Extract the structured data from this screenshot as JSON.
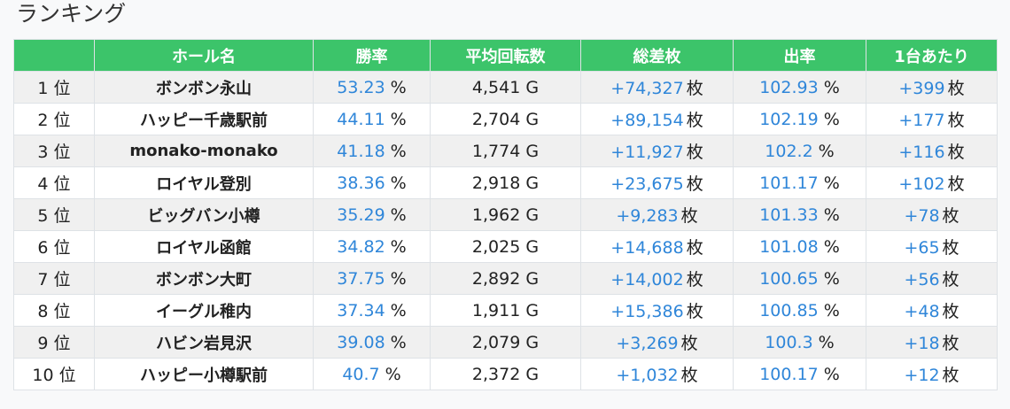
{
  "page": {
    "title": "ランキング"
  },
  "table": {
    "headers": [
      "",
      "ホール名",
      "勝率",
      "平均回転数",
      "総差枚",
      "出率",
      "1台あたり"
    ],
    "units": {
      "percent": "%",
      "spins": "G",
      "coins": "枚"
    },
    "rows": [
      {
        "rank": "1 位",
        "hall": "ボンボン永山",
        "win_rate": "53.23",
        "avg_spins": "4,541",
        "total_diff": "+74,327",
        "payout": "102.93",
        "per_machine": "+399"
      },
      {
        "rank": "2 位",
        "hall": "ハッピー千歳駅前",
        "win_rate": "44.11",
        "avg_spins": "2,704",
        "total_diff": "+89,154",
        "payout": "102.19",
        "per_machine": "+177"
      },
      {
        "rank": "3 位",
        "hall": "monako-monako",
        "win_rate": "41.18",
        "avg_spins": "1,774",
        "total_diff": "+11,927",
        "payout": "102.2",
        "per_machine": "+116"
      },
      {
        "rank": "4 位",
        "hall": "ロイヤル登別",
        "win_rate": "38.36",
        "avg_spins": "2,918",
        "total_diff": "+23,675",
        "payout": "101.17",
        "per_machine": "+102"
      },
      {
        "rank": "5 位",
        "hall": "ビッグバン小樽",
        "win_rate": "35.29",
        "avg_spins": "1,962",
        "total_diff": "+9,283",
        "payout": "101.33",
        "per_machine": "+78"
      },
      {
        "rank": "6 位",
        "hall": "ロイヤル函館",
        "win_rate": "34.82",
        "avg_spins": "2,025",
        "total_diff": "+14,688",
        "payout": "101.08",
        "per_machine": "+65"
      },
      {
        "rank": "7 位",
        "hall": "ボンボン大町",
        "win_rate": "37.75",
        "avg_spins": "2,892",
        "total_diff": "+14,002",
        "payout": "100.65",
        "per_machine": "+56"
      },
      {
        "rank": "8 位",
        "hall": "イーグル稚内",
        "win_rate": "37.34",
        "avg_spins": "1,911",
        "total_diff": "+15,386",
        "payout": "100.85",
        "per_machine": "+48"
      },
      {
        "rank": "9 位",
        "hall": "ハビン岩見沢",
        "win_rate": "39.08",
        "avg_spins": "2,079",
        "total_diff": "+3,269",
        "payout": "100.3",
        "per_machine": "+18"
      },
      {
        "rank": "10 位",
        "hall": "ハッピー小樽駅前",
        "win_rate": "40.7",
        "avg_spins": "2,372",
        "total_diff": "+1,032",
        "payout": "100.17",
        "per_machine": "+12"
      }
    ]
  },
  "colors": {
    "header_bg": "#3cc46a",
    "accent_value": "#2f86d9",
    "row_striped": "#f0f0f0",
    "row_plain": "#ffffff"
  }
}
